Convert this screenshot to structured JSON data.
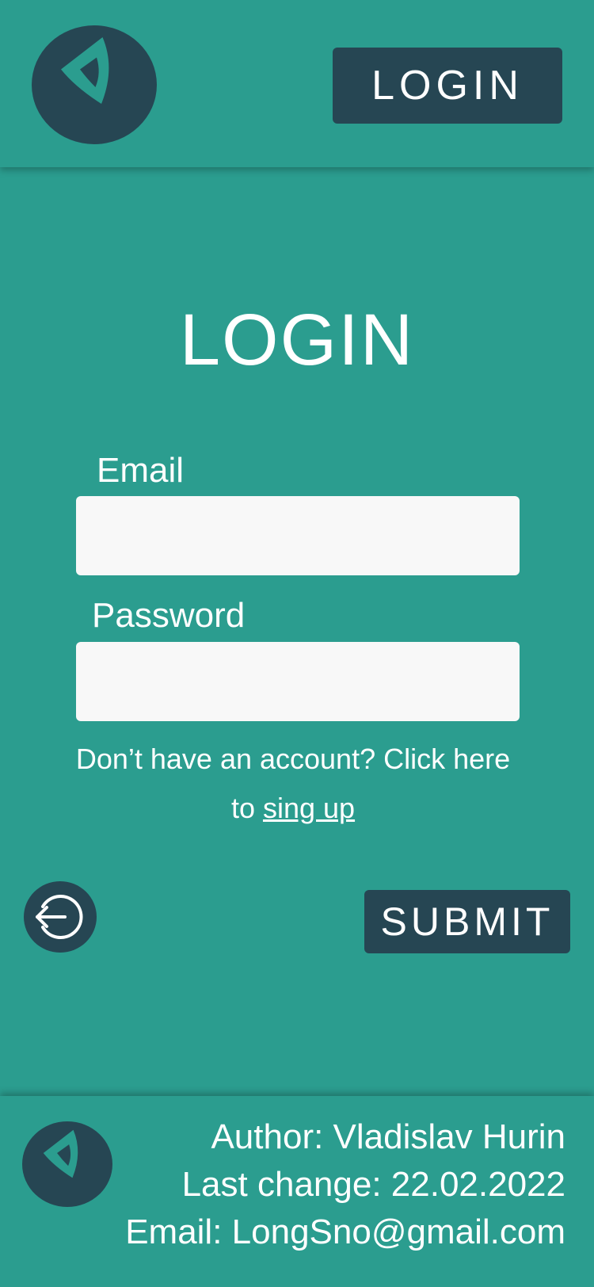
{
  "colors": {
    "background": "#2b9d8f",
    "dark": "#264653",
    "input": "#f8f8f8",
    "text": "#ffffff"
  },
  "header": {
    "logo_icon": "app-logo-icon",
    "login_button_label": "LOGIN"
  },
  "form": {
    "title": "LOGIN",
    "email_label": "Email",
    "email_value": "",
    "password_label": "Password",
    "password_value": "",
    "signup_prompt": "Don’t have an account? Click here to ",
    "signup_link": "sing up",
    "back_icon": "logout-arrow-icon",
    "submit_label": "SUBMIT"
  },
  "footer": {
    "logo_icon": "app-logo-icon",
    "author": "Author: Vladislav Hurin",
    "last_change": "Last change: 22.02.2022",
    "email": "Email: LongSno@gmail.com"
  }
}
